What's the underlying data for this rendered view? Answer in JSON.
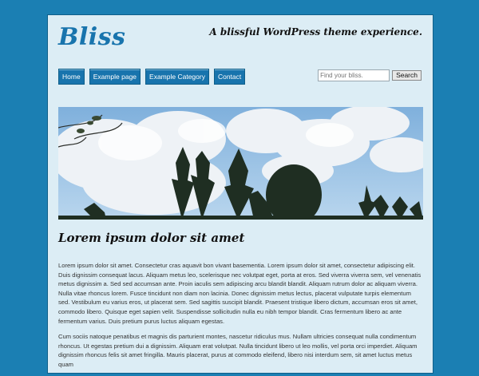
{
  "site": {
    "title": "Bliss",
    "tagline": "A blissful WordPress theme experience."
  },
  "nav": {
    "items": [
      {
        "label": "Home"
      },
      {
        "label": "Example page"
      },
      {
        "label": "Example Category"
      },
      {
        "label": "Contact"
      }
    ]
  },
  "search": {
    "placeholder": "Find your bliss.",
    "button_label": "Search"
  },
  "post": {
    "title": "Lorem ipsum dolor sit amet",
    "paragraphs": [
      "Lorem ipsum dolor sit amet. Consectetur cras aquavit bon vivant basementia.  Lorem ipsum dolor sit amet, consectetur adipiscing elit. Duis dignissim consequat lacus. Aliquam metus leo, scelerisque nec volutpat eget, porta at eros. Sed viverra viverra sem, vel venenatis metus dignissim a. Sed sed accumsan ante. Proin iaculis sem adipiscing arcu blandit blandit. Aliquam rutrum dolor ac aliquam viverra. Nulla vitae rhoncus lorem. Fusce tincidunt non diam non lacinia. Donec dignissim metus lectus, placerat vulputate turpis elementum sed. Vestibulum eu varius eros, ut placerat sem. Sed sagittis suscipit blandit. Praesent tristique libero dictum, accumsan eros sit amet, commodo libero. Quisque eget sapien velit. Suspendisse sollicitudin nulla eu nibh tempor blandit. Cras fermentum libero ac ante fermentum varius. Duis pretium purus luctus aliquam egestas.",
      "Cum sociis natoque penatibus et magnis dis parturient montes, nascetur ridiculus mus. Nullam ultricies consequat nulla condimentum rhoncus. Ut egestas pretium dui a dignissim. Aliquam erat volutpat. Nulla tincidunt libero ut leo mollis, vel porta orci imperdiet. Aliquam dignissim rhoncus felis sit amet fringilla. Mauris placerat, purus at commodo eleifend, libero nisi interdum sem, sit amet luctus metus quam"
    ]
  },
  "colors": {
    "background": "#1b7fb3",
    "page": "#dcedf5",
    "accent": "#1874ad"
  }
}
